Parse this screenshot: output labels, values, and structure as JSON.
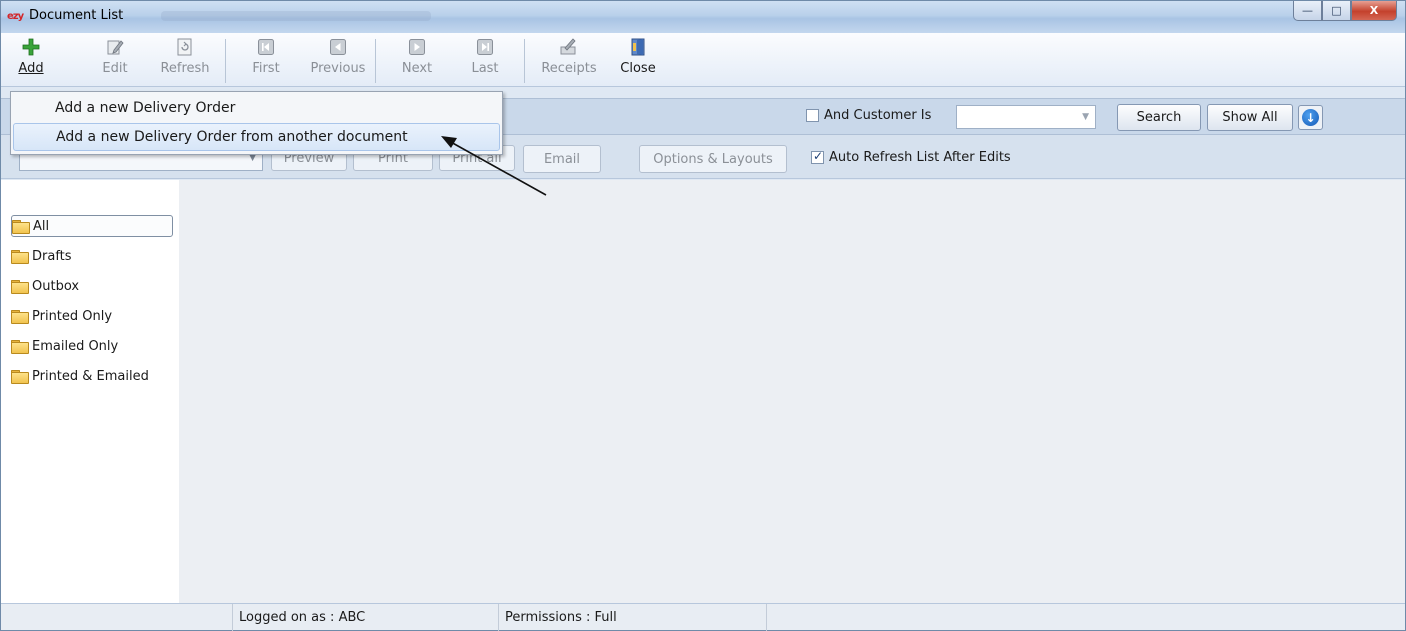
{
  "window": {
    "title": "Document List",
    "app_icon_text": "ezy",
    "controls": {
      "minimize": "—",
      "maximize": "□",
      "close": "X"
    }
  },
  "toolbar": {
    "add": "Add",
    "edit": "Edit",
    "refresh": "Refresh",
    "first": "First",
    "previous": "Previous",
    "next": "Next",
    "last": "Last",
    "receipts": "Receipts",
    "close": "Close"
  },
  "add_menu": {
    "items": [
      {
        "label": "Add a new Delivery Order"
      },
      {
        "label": "Add a new Delivery Order from another document"
      }
    ]
  },
  "filter": {
    "and_customer_label": "And Customer Is",
    "and_customer_checked": false,
    "customer_value": "",
    "search": "Search",
    "show_all": "Show All"
  },
  "layout_bar": {
    "layout_value": "",
    "preview": "Preview",
    "print": "Print",
    "print_all": "Print all",
    "email": "Email",
    "options_layouts": "Options & Layouts",
    "auto_refresh_label": "Auto Refresh List After Edits",
    "auto_refresh_checked": true
  },
  "sidebar": {
    "items": [
      {
        "label": "All",
        "selected": true
      },
      {
        "label": "Drafts"
      },
      {
        "label": "Outbox"
      },
      {
        "label": "Printed Only"
      },
      {
        "label": "Emailed Only"
      },
      {
        "label": "Printed & Emailed"
      }
    ]
  },
  "status": {
    "logged_on": "Logged on as : ABC",
    "permissions": "Permissions : Full"
  },
  "colors": {
    "title_bar": "#b9d0ea",
    "close_button": "#c4412c",
    "filter_bar": "#c9d8ea",
    "content_bg": "#eceff3",
    "add_icon": "#3aa33a"
  }
}
